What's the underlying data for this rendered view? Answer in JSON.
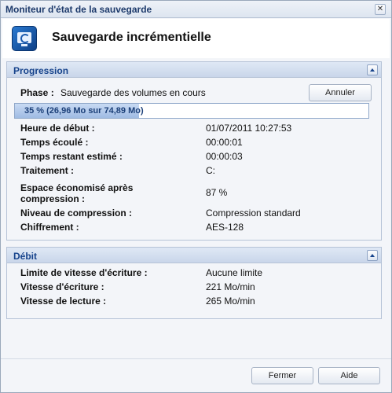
{
  "window": {
    "title": "Moniteur d'état de la sauvegarde",
    "close_symbol": "✕"
  },
  "header": {
    "title": "Sauvegarde incrémentielle",
    "icon": "backup-monitor-icon"
  },
  "progression": {
    "section_title": "Progression",
    "phase_label": "Phase :",
    "phase_value": "Sauvegarde des volumes en cours",
    "cancel_label": "Annuler",
    "progress_percent": 35,
    "progress_text": "35 % (26,96 Mo sur 74,89 Mo)",
    "rows": [
      {
        "label": "Heure de début :",
        "value": "01/07/2011 10:27:53"
      },
      {
        "label": "Temps écoulé :",
        "value": "00:00:01"
      },
      {
        "label": "Temps restant estimé :",
        "value": "00:00:03"
      },
      {
        "label": "Traitement :",
        "value": "C:"
      },
      {
        "label": "Espace économisé après\ncompression :",
        "value": "87 %"
      },
      {
        "label": "Niveau de compression :",
        "value": "Compression standard"
      },
      {
        "label": "Chiffrement :",
        "value": "AES-128"
      }
    ]
  },
  "debit": {
    "section_title": "Débit",
    "rows": [
      {
        "label": "Limite de vitesse d'écriture :",
        "value": "Aucune limite"
      },
      {
        "label": "Vitesse d'écriture :",
        "value": "221 Mo/min"
      },
      {
        "label": "Vitesse de lecture :",
        "value": "265 Mo/min"
      }
    ]
  },
  "footer": {
    "close_label": "Fermer",
    "help_label": "Aide"
  },
  "colors": {
    "accent": "#15428b",
    "progress": "#9fbbe3"
  }
}
